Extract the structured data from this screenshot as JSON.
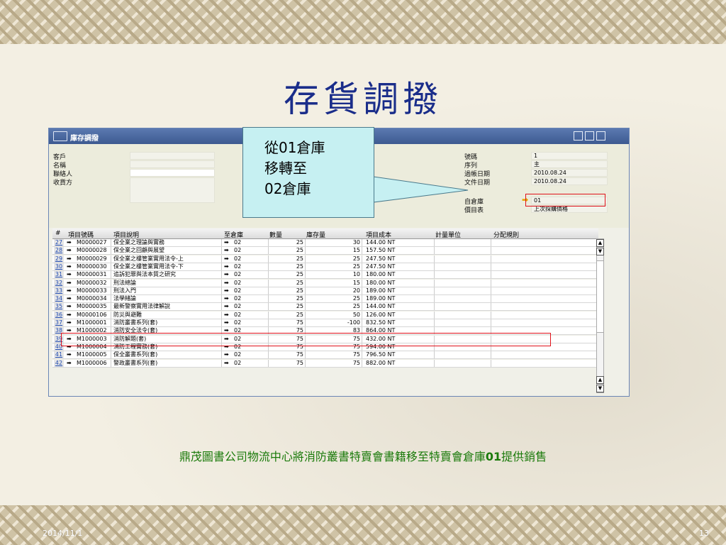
{
  "slide": {
    "title": "存貨調撥",
    "caption_pre": "鼎茂圖書公司物流中心將消防叢書特賣會書籍移至特賣會倉庫",
    "caption_bold": "01",
    "caption_post": "提供銷售",
    "date": "2014/11/1",
    "page": "13"
  },
  "callout": {
    "line1": "從01倉庫",
    "line2": "移轉至",
    "line3": "02倉庫"
  },
  "window": {
    "title": "庫存調撥",
    "left_fields": [
      {
        "label": "客戶",
        "value": ""
      },
      {
        "label": "名稱",
        "value": ""
      },
      {
        "label": "聯絡人",
        "value": ""
      },
      {
        "label": "收貨方",
        "value": ""
      }
    ],
    "right_fields": {
      "number_label": "號碼",
      "number_value": "1",
      "series_label": "序列",
      "series_value": "主",
      "posting_date_label": "過帳日期",
      "posting_date_value": "2010.08.24",
      "doc_date_label": "文件日期",
      "doc_date_value": "2010.08.24",
      "from_wh_label": "自倉庫",
      "from_wh_value": "01",
      "price_list_label": "價目表",
      "price_list_value": "上次採購價格"
    }
  },
  "grid": {
    "headers": [
      "#",
      "項目號碼",
      "項目說明",
      "至倉庫",
      "數量",
      "庫存量",
      "項目成本",
      "計量單位",
      "分配規則"
    ],
    "rows": [
      {
        "n": "27",
        "code": "M0000027",
        "desc": "保全業之理論與實務",
        "wh": "02",
        "qty": "25",
        "stock": "30",
        "cost": "144.00 NT"
      },
      {
        "n": "28",
        "code": "M0000028",
        "desc": "保全業之回顧與展望",
        "wh": "02",
        "qty": "25",
        "stock": "15",
        "cost": "157.50 NT"
      },
      {
        "n": "29",
        "code": "M0000029",
        "desc": "保全業之樓管業實用法令-上",
        "wh": "02",
        "qty": "25",
        "stock": "25",
        "cost": "247.50 NT"
      },
      {
        "n": "30",
        "code": "M0000030",
        "desc": "保全業之樓管業實用法令-下",
        "wh": "02",
        "qty": "25",
        "stock": "25",
        "cost": "247.50 NT"
      },
      {
        "n": "31",
        "code": "M0000031",
        "desc": "追訴犯罪與法本質之研究",
        "wh": "02",
        "qty": "25",
        "stock": "10",
        "cost": "180.00 NT"
      },
      {
        "n": "32",
        "code": "M0000032",
        "desc": "刑法總論",
        "wh": "02",
        "qty": "25",
        "stock": "15",
        "cost": "180.00 NT"
      },
      {
        "n": "33",
        "code": "M0000033",
        "desc": "刑法入門",
        "wh": "02",
        "qty": "25",
        "stock": "20",
        "cost": "189.00 NT"
      },
      {
        "n": "34",
        "code": "M0000034",
        "desc": "法學緒論",
        "wh": "02",
        "qty": "25",
        "stock": "25",
        "cost": "189.00 NT"
      },
      {
        "n": "35",
        "code": "M0000035",
        "desc": "最新警察實用法律解說",
        "wh": "02",
        "qty": "25",
        "stock": "25",
        "cost": "144.00 NT"
      },
      {
        "n": "36",
        "code": "M0000106",
        "desc": "防災與避難",
        "wh": "02",
        "qty": "25",
        "stock": "50",
        "cost": "126.00 NT"
      },
      {
        "n": "37",
        "code": "M1000001",
        "desc": "消防叢書系列(套)",
        "wh": "02",
        "qty": "75",
        "stock": "-100",
        "cost": "832.50 NT"
      },
      {
        "n": "38",
        "code": "M1000002",
        "desc": "消防安全法令(套)",
        "wh": "02",
        "qty": "75",
        "stock": "83",
        "cost": "864.00 NT"
      },
      {
        "n": "39",
        "code": "M1000003",
        "desc": "消防解題(套)",
        "wh": "02",
        "qty": "75",
        "stock": "75",
        "cost": "432.00 NT"
      },
      {
        "n": "40",
        "code": "M1000004",
        "desc": "消防工程實務(套)",
        "wh": "02",
        "qty": "75",
        "stock": "75",
        "cost": "594.00 NT"
      },
      {
        "n": "41",
        "code": "M1000005",
        "desc": "保全叢書系列(套)",
        "wh": "02",
        "qty": "75",
        "stock": "75",
        "cost": "796.50 NT"
      },
      {
        "n": "42",
        "code": "M1000006",
        "desc": "警政叢書系列(套)",
        "wh": "02",
        "qty": "75",
        "stock": "75",
        "cost": "882.00 NT"
      }
    ]
  },
  "colors": {
    "title": "#1a2d8a",
    "caption": "#1a7a0a",
    "highlight": "#e0111a",
    "callout_fill": "#c6f0f2",
    "arrow": "#e6a300"
  },
  "icons": {
    "link_arrow": "link-arrow-icon",
    "window_title": "document-icon"
  }
}
